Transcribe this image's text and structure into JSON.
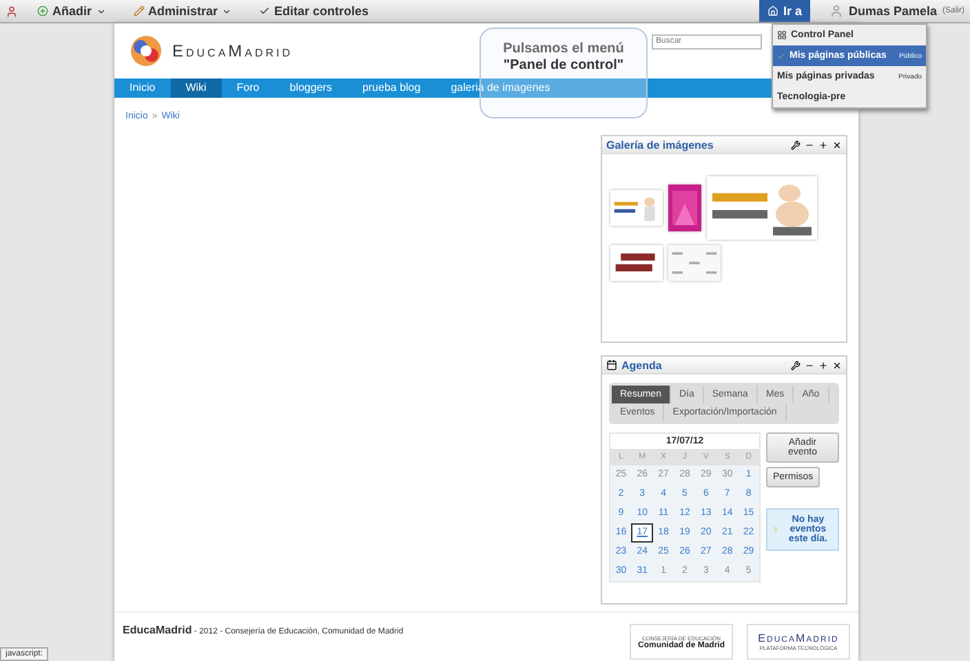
{
  "toolbar": {
    "items": [
      {
        "label": "Añadir",
        "kind": "add"
      },
      {
        "label": "Administrar",
        "kind": "admin"
      },
      {
        "label": "Editar controles",
        "kind": "edit"
      }
    ],
    "goto": "Ir a",
    "user": "Dumas Pamela",
    "logout": "(Salir)"
  },
  "header": {
    "logo": "EducaMadrid",
    "search": {
      "placeholder": "Buscar"
    }
  },
  "nav": [
    {
      "label": "Inicio",
      "selected": false
    },
    {
      "label": "Wiki",
      "selected": true
    },
    {
      "label": "Foro",
      "selected": false
    },
    {
      "label": "bloggers",
      "selected": false
    },
    {
      "label": "prueba blog",
      "selected": false
    },
    {
      "label": "galeria de imagenes",
      "selected": false
    }
  ],
  "breadcrumb": {
    "items": [
      "Inicio",
      "Wiki"
    ],
    "separator": "»"
  },
  "gallery": {
    "title": "Galería de imágenes"
  },
  "agenda": {
    "title": "Agenda",
    "tabs": [
      {
        "label": "Resumen",
        "selected": true
      },
      {
        "label": "Día",
        "selected": false
      },
      {
        "label": "Semana",
        "selected": false
      },
      {
        "label": "Mes",
        "selected": false
      },
      {
        "label": "Año",
        "selected": false
      },
      {
        "label": "Eventos",
        "selected": false
      },
      {
        "label": "Exportación/Importación",
        "selected": false
      }
    ],
    "calendar": {
      "title": "17/07/12",
      "weekdays": [
        "L",
        "M",
        "X",
        "J",
        "V",
        "S",
        "D"
      ],
      "weeks": [
        [
          {
            "day": "25",
            "muted": true,
            "selected": false
          },
          {
            "day": "26",
            "muted": true,
            "selected": false
          },
          {
            "day": "27",
            "muted": true,
            "selected": false
          },
          {
            "day": "28",
            "muted": true,
            "selected": false
          },
          {
            "day": "29",
            "muted": true,
            "selected": false
          },
          {
            "day": "30",
            "muted": true,
            "selected": false
          },
          {
            "day": "1",
            "muted": false,
            "selected": false
          }
        ],
        [
          {
            "day": "2",
            "muted": false,
            "selected": false
          },
          {
            "day": "3",
            "muted": false,
            "selected": false
          },
          {
            "day": "4",
            "muted": false,
            "selected": false
          },
          {
            "day": "5",
            "muted": false,
            "selected": false
          },
          {
            "day": "6",
            "muted": false,
            "selected": false
          },
          {
            "day": "7",
            "muted": false,
            "selected": false
          },
          {
            "day": "8",
            "muted": false,
            "selected": false
          }
        ],
        [
          {
            "day": "9",
            "muted": false,
            "selected": false
          },
          {
            "day": "10",
            "muted": false,
            "selected": false
          },
          {
            "day": "11",
            "muted": false,
            "selected": false
          },
          {
            "day": "12",
            "muted": false,
            "selected": false
          },
          {
            "day": "13",
            "muted": false,
            "selected": false
          },
          {
            "day": "14",
            "muted": false,
            "selected": false
          },
          {
            "day": "15",
            "muted": false,
            "selected": false
          }
        ],
        [
          {
            "day": "16",
            "muted": false,
            "selected": false
          },
          {
            "day": "17",
            "muted": false,
            "selected": true
          },
          {
            "day": "18",
            "muted": false,
            "selected": false
          },
          {
            "day": "19",
            "muted": false,
            "selected": false
          },
          {
            "day": "20",
            "muted": false,
            "selected": false
          },
          {
            "day": "21",
            "muted": false,
            "selected": false
          },
          {
            "day": "22",
            "muted": false,
            "selected": false
          }
        ],
        [
          {
            "day": "23",
            "muted": false,
            "selected": false
          },
          {
            "day": "24",
            "muted": false,
            "selected": false
          },
          {
            "day": "25",
            "muted": false,
            "selected": false
          },
          {
            "day": "26",
            "muted": false,
            "selected": false
          },
          {
            "day": "27",
            "muted": false,
            "selected": false
          },
          {
            "day": "28",
            "muted": false,
            "selected": false
          },
          {
            "day": "29",
            "muted": false,
            "selected": false
          }
        ],
        [
          {
            "day": "30",
            "muted": false,
            "selected": false
          },
          {
            "day": "31",
            "muted": false,
            "selected": false
          },
          {
            "day": "1",
            "muted": true,
            "selected": false
          },
          {
            "day": "2",
            "muted": true,
            "selected": false
          },
          {
            "day": "3",
            "muted": true,
            "selected": false
          },
          {
            "day": "4",
            "muted": true,
            "selected": false
          },
          {
            "day": "5",
            "muted": true,
            "selected": false
          }
        ]
      ]
    },
    "buttons": [
      "Añadir evento",
      "Permisos"
    ],
    "notice": "No hay eventos este día."
  },
  "footer": {
    "text": "**EducaMadrid** - 2012 - Consejería de Educación, Comunidad de Madrid",
    "logo1_small": "CONSEJERÍA DE EDUCACIÓN",
    "logo1": "Comunidad de Madrid",
    "logo2": "EducaMadrid",
    "logo2_sub": "PLATAFORMA TECNOLÓGICA"
  },
  "callout": [
    "Pulsamos el menú",
    "\"Panel de control\""
  ],
  "dropdown": [
    {
      "label": "Control Panel",
      "selected": false,
      "kind": "panel"
    },
    {
      "label": "Mis páginas públicas",
      "badge": "Público",
      "selected": true,
      "kind": "page"
    },
    {
      "label": "Mis páginas privadas",
      "badge": "Privado",
      "selected": false,
      "kind": "page"
    },
    {
      "label": "Tecnologia-pre",
      "selected": false,
      "kind": "page"
    }
  ],
  "status": "javascript:"
}
